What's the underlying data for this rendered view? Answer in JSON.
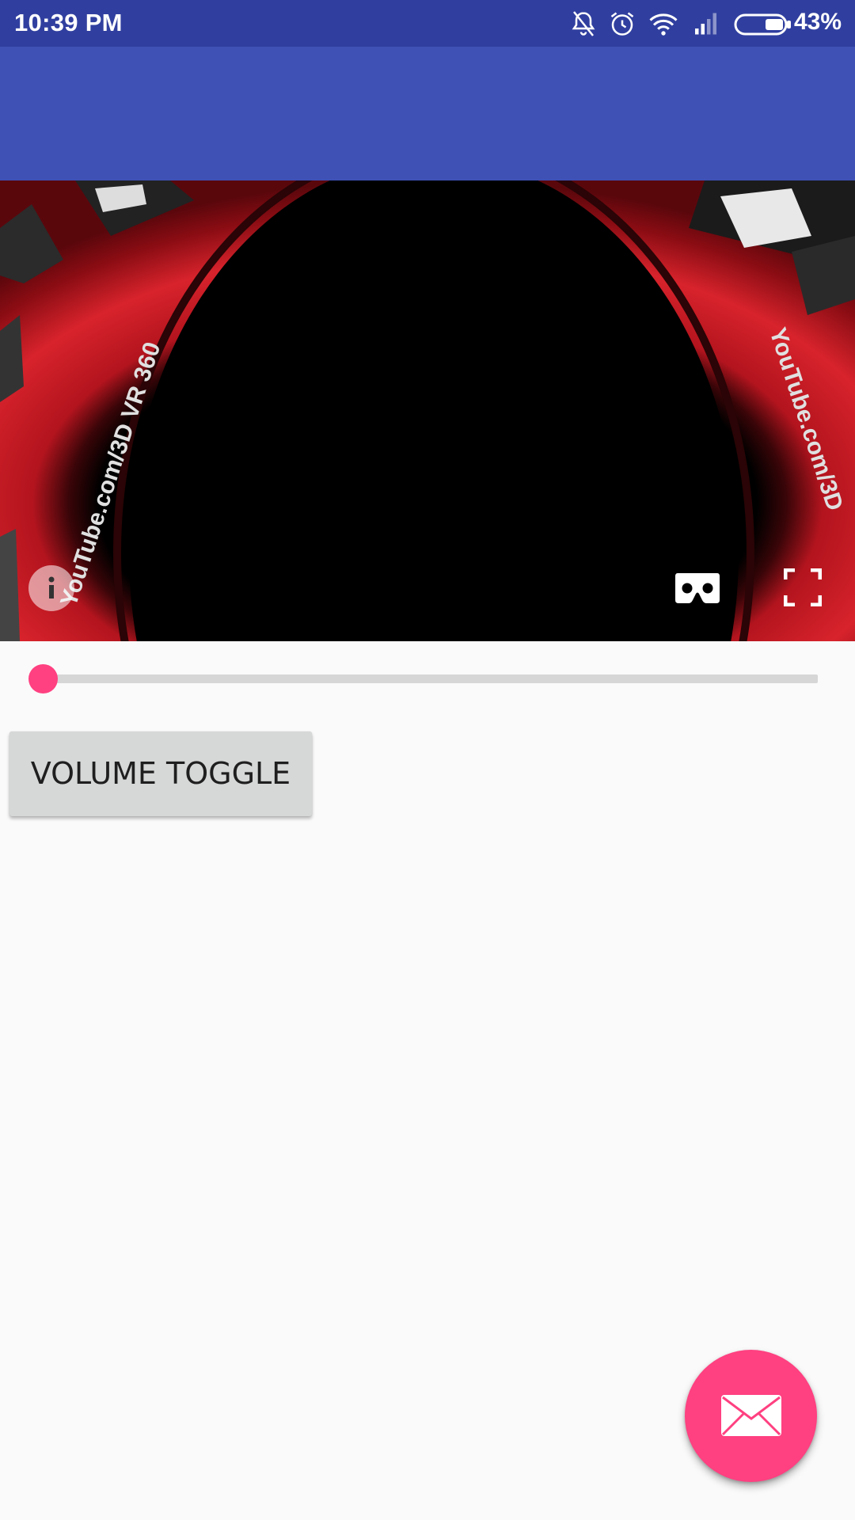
{
  "status_bar": {
    "time": "10:39 PM",
    "battery_percent": "43%",
    "icons": [
      "notifications-off-icon",
      "alarm-icon",
      "wifi-icon",
      "signal-icon",
      "battery-icon"
    ],
    "color": "#303f9f"
  },
  "app_bar": {
    "color": "#3f51b5"
  },
  "video_player": {
    "controls": [
      "info-icon",
      "cardboard-vr-icon",
      "fullscreen-icon"
    ],
    "watermark_left": "YouTube.com/3D VR 360",
    "watermark_right": "YouTube.com/3D"
  },
  "seek_bar": {
    "progress": 0,
    "accent_color": "#ff4081"
  },
  "controls": {
    "volume_toggle_label": "VOLUME TOGGLE"
  },
  "fab": {
    "icon": "email-icon",
    "color": "#ff4081"
  }
}
